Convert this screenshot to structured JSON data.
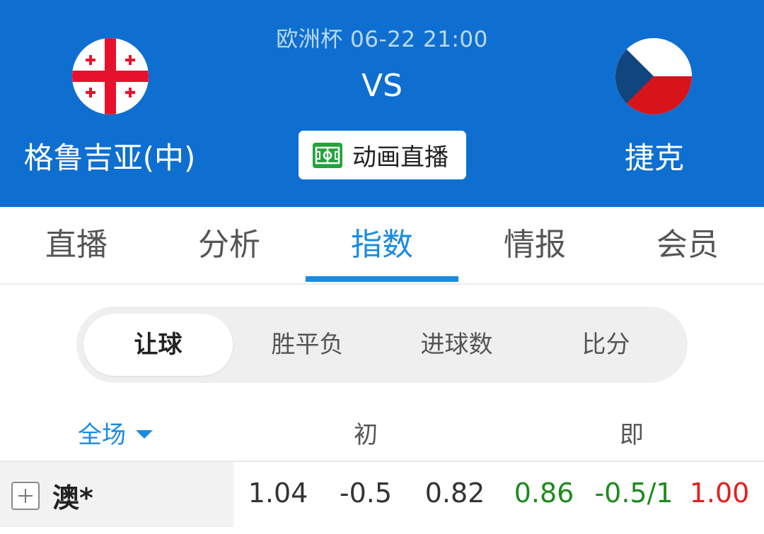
{
  "match": {
    "info": "欧洲杯 06-22 21:00",
    "vs": "VS",
    "home_team": "格鲁吉亚(中)",
    "away_team": "捷克",
    "live_animation_label": "动画直播"
  },
  "tabs": [
    "直播",
    "分析",
    "指数",
    "情报",
    "会员"
  ],
  "active_tab": "指数",
  "odds_types": [
    "让球",
    "胜平负",
    "进球数",
    "比分"
  ],
  "active_odds_type": "让球",
  "columns": {
    "scope": "全场",
    "initial": "初",
    "live": "即"
  },
  "rows": [
    {
      "company": "澳*",
      "initial": [
        "1.04",
        "-0.5",
        "0.82"
      ],
      "live": [
        "0.86",
        "-0.5/1",
        "1.00"
      ]
    }
  ],
  "colors": {
    "header_bg": "#0f6fd0",
    "accent": "#1a8be0",
    "down": "#1e8a1e",
    "up": "#e02020"
  },
  "icons": {
    "home_flag": "georgia-flag",
    "away_flag": "czech-flag",
    "live": "pitch-icon",
    "scope_dropdown": "caret-down-icon",
    "expand": "plus-icon"
  }
}
